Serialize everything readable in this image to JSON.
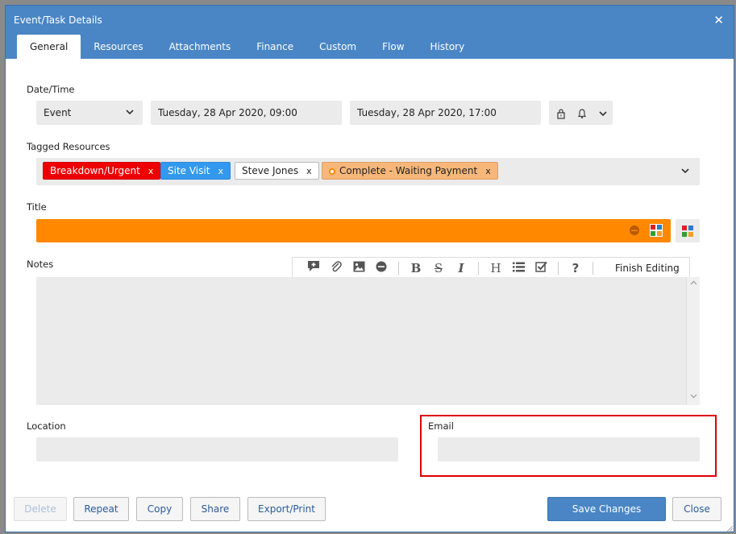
{
  "dialog": {
    "title": "Event/Task Details",
    "close_glyph": "✕",
    "tabs": [
      "General",
      "Resources",
      "Attachments",
      "Finance",
      "Custom",
      "Flow",
      "History"
    ],
    "active_tab": "General"
  },
  "datetime": {
    "label": "Date/Time",
    "type_value": "Event",
    "start": "Tuesday, 28 Apr 2020, 09:00",
    "end": "Tuesday, 28 Apr 2020, 17:00",
    "icons": [
      "lock-icon",
      "bell-icon",
      "chevron-down-icon"
    ]
  },
  "tagged": {
    "label": "Tagged Resources",
    "tags": [
      {
        "text": "Breakdown/Urgent",
        "bg": "#ee0000",
        "color": "#ffffff"
      },
      {
        "text": "Site Visit",
        "bg": "#3399ee",
        "color": "#ffffff"
      },
      {
        "text": "Steve Jones",
        "bg": "#ffffff",
        "color": "#222222"
      },
      {
        "text": "Complete - Waiting Payment",
        "bg": "#f7b77a",
        "color": "#222222"
      }
    ],
    "remove_glyph": "x"
  },
  "title_field": {
    "label": "Title",
    "value": "",
    "color": "#ff8800"
  },
  "notes": {
    "label": "Notes",
    "toolbar_icons": [
      "comment-add-icon",
      "paperclip-icon",
      "image-icon",
      "emoji-icon",
      "bold-icon",
      "strikethrough-icon",
      "italic-icon",
      "heading-icon",
      "list-icon",
      "checkbox-icon",
      "help-icon"
    ],
    "bold": "B",
    "strike": "S",
    "italic": "I",
    "heading": "H",
    "help": "?",
    "finish_editing": "Finish Editing",
    "value": ""
  },
  "location": {
    "label": "Location",
    "value": ""
  },
  "email": {
    "label": "Email",
    "value": ""
  },
  "footer": {
    "delete": "Delete",
    "repeat": "Repeat",
    "copy": "Copy",
    "share": "Share",
    "export": "Export/Print",
    "save": "Save Changes",
    "close": "Close"
  },
  "colors": {
    "accent": "#4a86c5",
    "title_orange": "#ff8800",
    "highlight_red": "#e00000"
  }
}
